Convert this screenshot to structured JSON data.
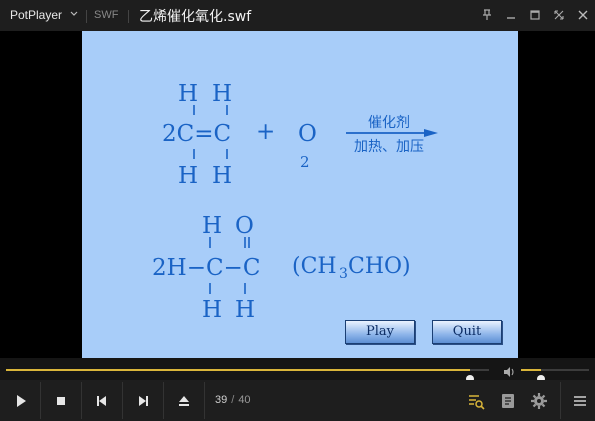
{
  "titlebar": {
    "app_name": "PotPlayer",
    "format": "SWF",
    "file_name": "乙烯催化氧化.swf"
  },
  "slide": {
    "reaction1": {
      "coef": "2C=C",
      "h_label": "H",
      "plus": "+",
      "o2": "O",
      "o2_sub": "2",
      "arrow_top": "催化剂",
      "arrow_bottom": "加热、加压"
    },
    "reaction2": {
      "main": "2H−C−C",
      "h_label": "H",
      "o_label": "O",
      "formula_open": "(CH",
      "formula_sub": "3",
      "formula_close": "CHO)"
    },
    "buttons": {
      "play": "Play",
      "quit": "Quit"
    }
  },
  "seek": {
    "progress": 0.96
  },
  "volume": {
    "level": 0.29
  },
  "playlist_counter": {
    "current": "39",
    "separator": "/",
    "total": "40"
  },
  "colors": {
    "accent": "#d9b53a",
    "slide_bg": "#a8cdf9",
    "chem_text": "#1a63c5"
  }
}
